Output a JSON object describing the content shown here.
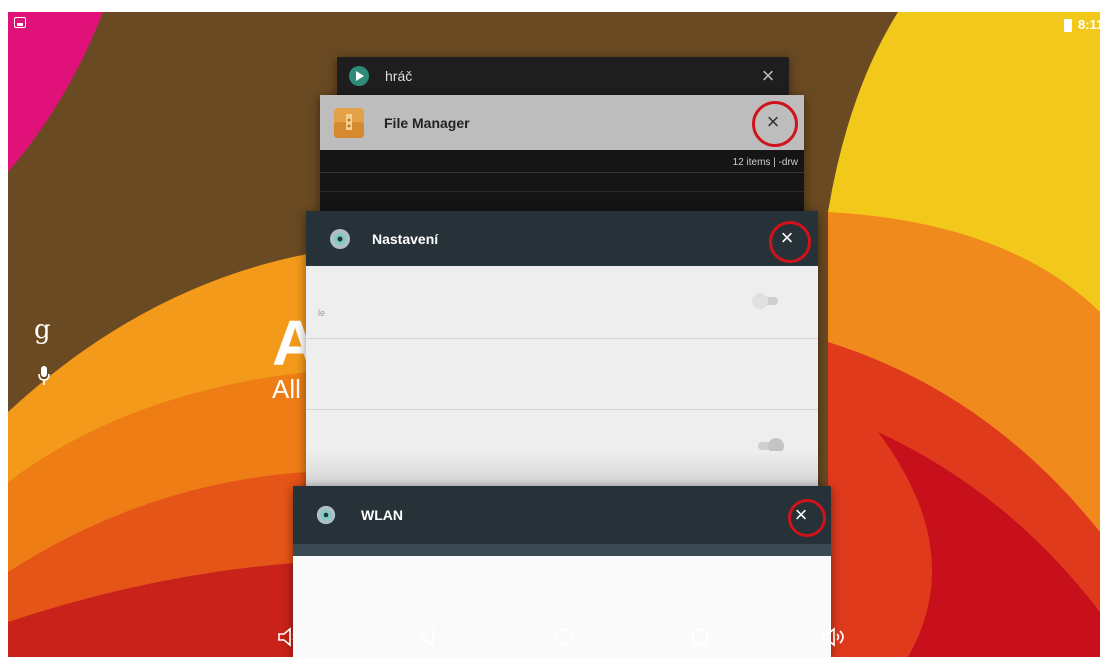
{
  "status_bar": {
    "time": "8:11",
    "left_icon": "image-icon",
    "battery_icon": "battery-icon"
  },
  "launcher": {
    "google_letter": "g",
    "mic_icon": "mic-icon",
    "app_title": "A",
    "app_subtitle": "All"
  },
  "recents": {
    "cards": [
      {
        "title": "hráč",
        "icon": "play-icon"
      },
      {
        "title": "File Manager",
        "icon": "folder-icon",
        "info": "12 items | -drw"
      },
      {
        "title": "Nastavení",
        "icon": "gear-icon",
        "row_fragment": "le"
      },
      {
        "title": "WLAN",
        "icon": "gear-icon"
      }
    ],
    "close_symbol": "×"
  },
  "nav_bar": {
    "buttons": [
      "volume-down-icon",
      "back-icon",
      "home-icon",
      "recents-icon",
      "volume-up-icon"
    ]
  },
  "colors": {
    "highlight_ring": "#d0131b",
    "settings_header": "#263238",
    "card_body": "#eeeeee"
  }
}
